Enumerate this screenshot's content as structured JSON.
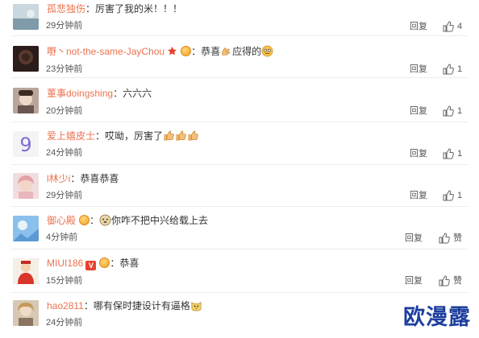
{
  "reply_label": "回复",
  "comments": [
    {
      "user": "孤悲独伤",
      "text": "厉害了我的米！！！",
      "time": "29分钟前",
      "likes": "4",
      "avatar_color": "#8aa7b8",
      "badges": [],
      "emojis": []
    },
    {
      "user": "嘢丶not-the-same-JayChou",
      "text": "恭喜",
      "text2": "应得的",
      "time": "23分钟前",
      "likes": "1",
      "avatar_color": "#2b1d1a",
      "badges": [
        "star-icon",
        "member-badge-icon"
      ],
      "emojis": [
        "clap-emoji",
        "good-emoji"
      ]
    },
    {
      "user": "董事doingshing",
      "text": "六六六",
      "time": "20分钟前",
      "likes": "1",
      "avatar_color": "#c9b3a6",
      "badges": [],
      "emojis": []
    },
    {
      "user": "爱上嬉皮士",
      "text": "哎呦，厉害了",
      "time": "24分钟前",
      "likes": "1",
      "avatar_color": "#f3f3f3",
      "badges": [],
      "emojis": [
        "thumbs-up-emoji",
        "thumbs-up-emoji",
        "thumbs-up-emoji"
      ]
    },
    {
      "user": "l林少i",
      "text": "恭喜恭喜",
      "time": "29分钟前",
      "likes": "1",
      "avatar_color": "#e7c2c2",
      "badges": [],
      "emojis": []
    },
    {
      "user": "御心殿",
      "text": "你咋不把中兴给载上去",
      "time": "4分钟前",
      "likes": "赞",
      "avatar_color": "#7fb4e8",
      "badges": [
        "member-badge-icon"
      ],
      "emojis": [
        "doge-emoji"
      ]
    },
    {
      "user": "MIUI186",
      "text": "恭喜",
      "time": "15分钟前",
      "likes": "赞",
      "avatar_color": "#d84c3c",
      "badges": [
        "vip-v-icon",
        "member-badge-icon"
      ],
      "emojis": []
    },
    {
      "user": "hao2811",
      "text": "哪有保时捷设计有逼格",
      "time": "24分钟前",
      "likes": "",
      "avatar_color": "#c8b49a",
      "badges": [],
      "emojis": [
        "cat-face-emoji"
      ]
    }
  ],
  "watermark": "欧漫露",
  "colors": {
    "username": "#eb7350",
    "text": "#333333",
    "meta": "#555555",
    "watermark": "#1e3f9e"
  }
}
